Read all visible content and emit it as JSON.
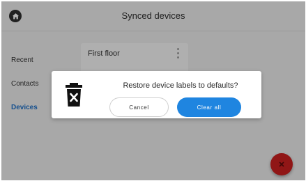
{
  "header": {
    "title": "Synced devices",
    "home_icon": "home-icon"
  },
  "sidebar": {
    "items": [
      {
        "label": "Recent",
        "active": false
      },
      {
        "label": "Contacts",
        "active": false
      },
      {
        "label": "Devices",
        "active": true
      }
    ]
  },
  "main": {
    "card": {
      "title": "First floor",
      "menu_icon": "more-vert-icon"
    }
  },
  "dialog": {
    "title": "Restore device labels to defaults?",
    "icon": "trash-clear-icon",
    "cancel_label": "Cancel",
    "confirm_label": "Clear all"
  },
  "fab": {
    "icon": "clear-icon",
    "color": "#c81f1f"
  },
  "colors": {
    "accent": "#1f85e0",
    "active_nav": "#1f6fc5",
    "background": "#e9e9e9"
  }
}
